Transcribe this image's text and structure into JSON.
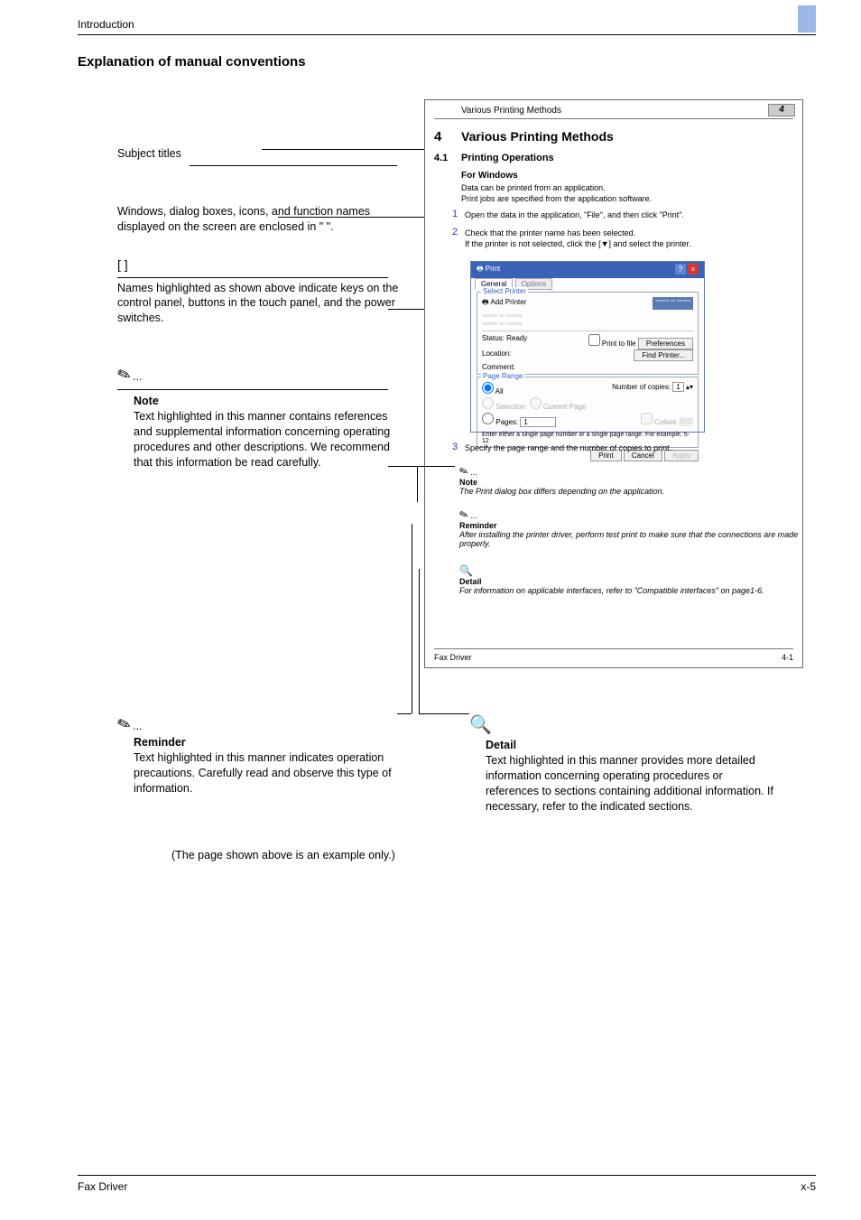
{
  "header": {
    "chapter": "Introduction",
    "page": "x-5",
    "footer_left": "Fax Driver"
  },
  "section_title": "Explanation of manual conventions",
  "example_note": "(The page shown above is an example only.)",
  "left": {
    "subject": "Subject titles",
    "windows": "Windows, dialog boxes, icons, and function names displayed on the screen are enclosed in \"  \".",
    "brackets": "[  ]",
    "brackets_body": "Names highlighted as shown above indicate keys on the control panel, buttons in the touch panel, and the power switches.",
    "note_title": "Note",
    "note_body": "Text highlighted in this manner contains references and supplemental information concerning operating procedures and other descriptions. We recommend that this information be read carefully."
  },
  "bottom": {
    "reminder_title": "Reminder",
    "reminder_body": "Text highlighted in this manner indicates operation precautions. Carefully read and observe this type of information.",
    "detail_title": "Detail",
    "detail_body": "Text highlighted in this manner provides more detailed information concerning operating procedures or references to sections containing additional information. If necessary, refer to the indicated sections."
  },
  "panel": {
    "hdr": "Various Printing Methods",
    "badge": "4",
    "chapno": "4",
    "chaptitle": "Various Printing Methods",
    "sec": "4.1",
    "sectitle": "Printing Operations",
    "sub": "For Windows",
    "l1": "Data can be printed from an application.",
    "l2": "Print jobs are specified from the application software.",
    "step1": "1",
    "step1t": "Open the data in the application, \"File\", and then click \"Print\".",
    "step2": "2",
    "step2t": "Check that the printer name has been selected.",
    "step2t2": "If the printer is not selected, click the [▼] and select the printer.",
    "step3": "3",
    "step3t": "Specify the page range and the number of copies to print.",
    "dlg": {
      "title": "Print",
      "tab1": "General",
      "tab2": "Options",
      "grp1": "Select Printer",
      "addp": "Add Printer",
      "status_l": "Status:",
      "status_v": "Ready",
      "loc": "Location:",
      "com": "Comment:",
      "ptf": "Print to file",
      "pref": "Preferences",
      "find": "Find Printer...",
      "grp2": "Page Range",
      "all": "All",
      "sel": "Selection",
      "cur": "Current Page",
      "pages": "Pages:",
      "pages_v": "1",
      "hint": "Enter either a single page number or a single page range. For example, 5-12",
      "ncop": "Number of copies:",
      "ncop_v": "1",
      "collate": "Collate",
      "print": "Print",
      "cancel": "Cancel",
      "apply": "Apply"
    },
    "note_t": "Note",
    "note_b": "The Print dialog box differs depending on the application.",
    "rem_t": "Reminder",
    "rem_b": "After installing the printer driver, perform test print to make sure that the connections are made properly.",
    "det_t": "Detail",
    "det_b": "For information on applicable interfaces, refer to \"Compatible interfaces\" on page1-6.",
    "footer_l": "Fax Driver",
    "footer_r": "4-1"
  }
}
